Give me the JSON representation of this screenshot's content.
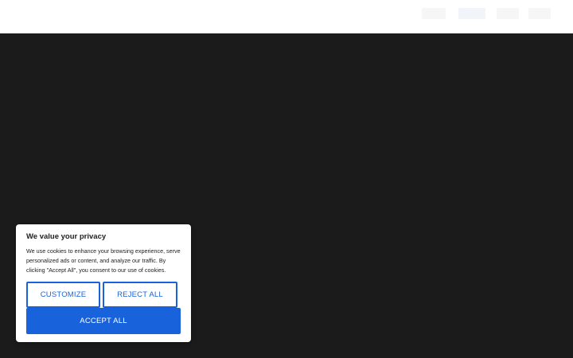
{
  "consent": {
    "title": "We value your privacy",
    "body": "We use cookies to enhance your browsing experience, serve personalized ads or content, and analyze our traffic. By clicking \"Accept All\", you consent to our use of cookies.",
    "customize_label": "CUSTOMIZE",
    "reject_label": "REJECT ALL",
    "accept_label": "ACCEPT ALL"
  },
  "colors": {
    "accent": "#1863dc",
    "page_background": "#1b1b1b",
    "header_background": "#ffffff"
  }
}
